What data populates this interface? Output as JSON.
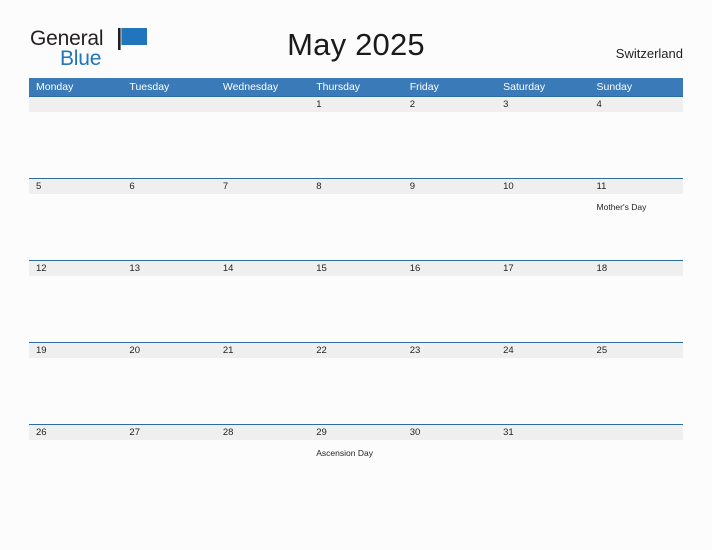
{
  "brand": {
    "name_part1": "General",
    "name_part2": "Blue",
    "flag_icon": "blue-flag-triangle-icon",
    "color_dark": "#231f20",
    "color_blue": "#2175bc"
  },
  "header": {
    "title": "May 2025",
    "country": "Switzerland"
  },
  "calendar": {
    "month": "May",
    "year": "2025",
    "header_color": "#3a7ab8",
    "date_band_color": "#efefef",
    "rule_color": "#2b6ca3",
    "weekday_headers": [
      "Monday",
      "Tuesday",
      "Wednesday",
      "Thursday",
      "Friday",
      "Saturday",
      "Sunday"
    ],
    "weeks": [
      {
        "dates": [
          "",
          "",
          "",
          "1",
          "2",
          "3",
          "4"
        ],
        "events": [
          "",
          "",
          "",
          "",
          "",
          "",
          ""
        ]
      },
      {
        "dates": [
          "5",
          "6",
          "7",
          "8",
          "9",
          "10",
          "11"
        ],
        "events": [
          "",
          "",
          "",
          "",
          "",
          "",
          "Mother's Day"
        ]
      },
      {
        "dates": [
          "12",
          "13",
          "14",
          "15",
          "16",
          "17",
          "18"
        ],
        "events": [
          "",
          "",
          "",
          "",
          "",
          "",
          ""
        ]
      },
      {
        "dates": [
          "19",
          "20",
          "21",
          "22",
          "23",
          "24",
          "25"
        ],
        "events": [
          "",
          "",
          "",
          "",
          "",
          "",
          ""
        ]
      },
      {
        "dates": [
          "26",
          "27",
          "28",
          "29",
          "30",
          "31",
          ""
        ],
        "events": [
          "",
          "",
          "",
          "Ascension Day",
          "",
          "",
          ""
        ]
      }
    ]
  }
}
